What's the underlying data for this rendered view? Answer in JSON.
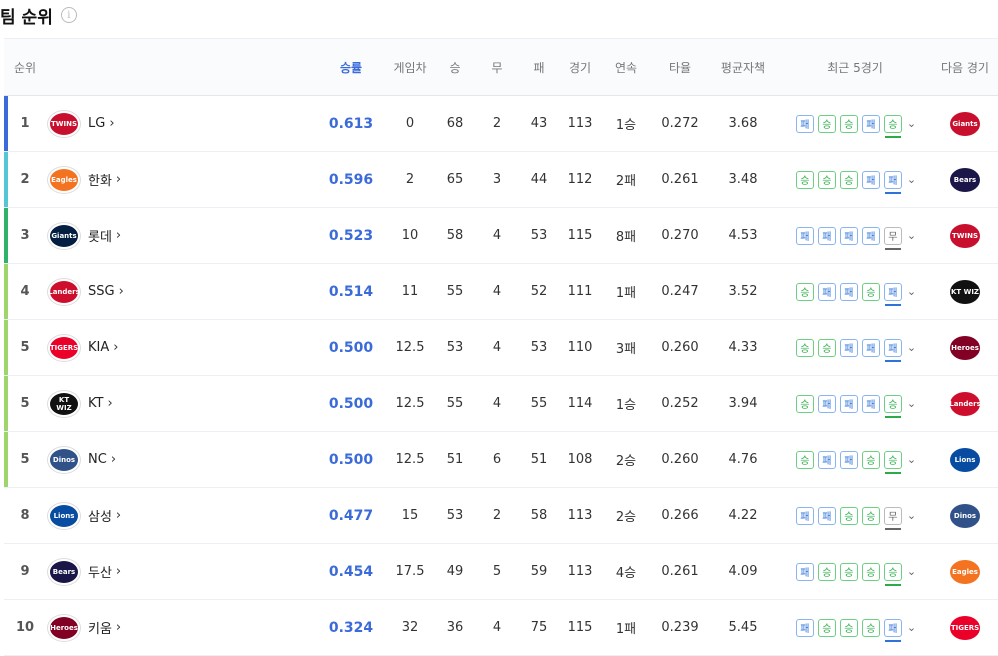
{
  "title": "팀 순위",
  "headers": {
    "rank": "순위",
    "pct": "승률",
    "gb": "게임차",
    "w": "승",
    "d": "무",
    "l": "패",
    "g": "경기",
    "streak": "연속",
    "avg": "타율",
    "era": "평균자책",
    "last5": "최근 5경기",
    "next": "다음 경기"
  },
  "colors": {
    "accent": "#3a6bd9",
    "win": "#2daa4a",
    "loss": "#2f73d9",
    "draw": "#666666"
  },
  "rows": [
    {
      "rank": "1",
      "team": "LG",
      "logo": "TWINS",
      "logo_color": "#c8102e",
      "pct": "0.613",
      "gb": "0",
      "w": "68",
      "d": "2",
      "l": "43",
      "g": "113",
      "streak": "1승",
      "avg": "0.272",
      "era": "3.68",
      "bar": "#3a6bd9",
      "last5": [
        "패",
        "승",
        "승",
        "패",
        "승"
      ],
      "next_logo": "Giants",
      "next_color": "#c8102e"
    },
    {
      "rank": "2",
      "team": "한화",
      "logo": "Eagles",
      "logo_color": "#f37321",
      "pct": "0.596",
      "gb": "2",
      "w": "65",
      "d": "3",
      "l": "44",
      "g": "112",
      "streak": "2패",
      "avg": "0.261",
      "era": "3.48",
      "bar": "#54c6d6",
      "last5": [
        "승",
        "승",
        "승",
        "패",
        "패"
      ],
      "next_logo": "Bears",
      "next_color": "#1a1748"
    },
    {
      "rank": "3",
      "team": "롯데",
      "logo": "Giants",
      "logo_color": "#041e42",
      "pct": "0.523",
      "gb": "10",
      "w": "58",
      "d": "4",
      "l": "53",
      "g": "115",
      "streak": "8패",
      "avg": "0.270",
      "era": "4.53",
      "bar": "#2fb36a",
      "last5": [
        "패",
        "패",
        "패",
        "패",
        "무"
      ],
      "next_logo": "TWINS",
      "next_color": "#c8102e"
    },
    {
      "rank": "4",
      "team": "SSG",
      "logo": "Landers",
      "logo_color": "#ce0e2d",
      "pct": "0.514",
      "gb": "11",
      "w": "55",
      "d": "4",
      "l": "52",
      "g": "111",
      "streak": "1패",
      "avg": "0.247",
      "era": "3.52",
      "bar": "#9fd66b",
      "last5": [
        "승",
        "패",
        "패",
        "승",
        "패"
      ],
      "next_logo": "KT WIZ",
      "next_color": "#111111"
    },
    {
      "rank": "5",
      "team": "KIA",
      "logo": "TIGERS",
      "logo_color": "#ea0029",
      "pct": "0.500",
      "gb": "12.5",
      "w": "53",
      "d": "4",
      "l": "53",
      "g": "110",
      "streak": "3패",
      "avg": "0.260",
      "era": "4.33",
      "bar": "#9fd66b",
      "last5": [
        "승",
        "승",
        "패",
        "패",
        "패"
      ],
      "next_logo": "Heroes",
      "next_color": "#820024"
    },
    {
      "rank": "5",
      "team": "KT",
      "logo": "KT WIZ",
      "logo_color": "#111111",
      "pct": "0.500",
      "gb": "12.5",
      "w": "55",
      "d": "4",
      "l": "55",
      "g": "114",
      "streak": "1승",
      "avg": "0.252",
      "era": "3.94",
      "bar": "#9fd66b",
      "last5": [
        "승",
        "패",
        "패",
        "패",
        "승"
      ],
      "next_logo": "Landers",
      "next_color": "#ce0e2d"
    },
    {
      "rank": "5",
      "team": "NC",
      "logo": "Dinos",
      "logo_color": "#315288",
      "pct": "0.500",
      "gb": "12.5",
      "w": "51",
      "d": "6",
      "l": "51",
      "g": "108",
      "streak": "2승",
      "avg": "0.260",
      "era": "4.76",
      "bar": "#9fd66b",
      "last5": [
        "승",
        "패",
        "패",
        "승",
        "승"
      ],
      "next_logo": "Lions",
      "next_color": "#074ca1"
    },
    {
      "rank": "8",
      "team": "삼성",
      "logo": "Lions",
      "logo_color": "#074ca1",
      "pct": "0.477",
      "gb": "15",
      "w": "53",
      "d": "2",
      "l": "58",
      "g": "113",
      "streak": "2승",
      "avg": "0.266",
      "era": "4.22",
      "bar": "",
      "last5": [
        "패",
        "패",
        "승",
        "승",
        "무"
      ],
      "next_logo": "Dinos",
      "next_color": "#315288"
    },
    {
      "rank": "9",
      "team": "두산",
      "logo": "Bears",
      "logo_color": "#1a1748",
      "pct": "0.454",
      "gb": "17.5",
      "w": "49",
      "d": "5",
      "l": "59",
      "g": "113",
      "streak": "4승",
      "avg": "0.261",
      "era": "4.09",
      "bar": "",
      "last5": [
        "패",
        "승",
        "승",
        "승",
        "승"
      ],
      "next_logo": "Eagles",
      "next_color": "#f37321"
    },
    {
      "rank": "10",
      "team": "키움",
      "logo": "Heroes",
      "logo_color": "#820024",
      "pct": "0.324",
      "gb": "32",
      "w": "36",
      "d": "4",
      "l": "75",
      "g": "115",
      "streak": "1패",
      "avg": "0.239",
      "era": "5.45",
      "bar": "",
      "last5": [
        "패",
        "승",
        "승",
        "승",
        "패"
      ],
      "next_logo": "TIGERS",
      "next_color": "#ea0029"
    }
  ]
}
